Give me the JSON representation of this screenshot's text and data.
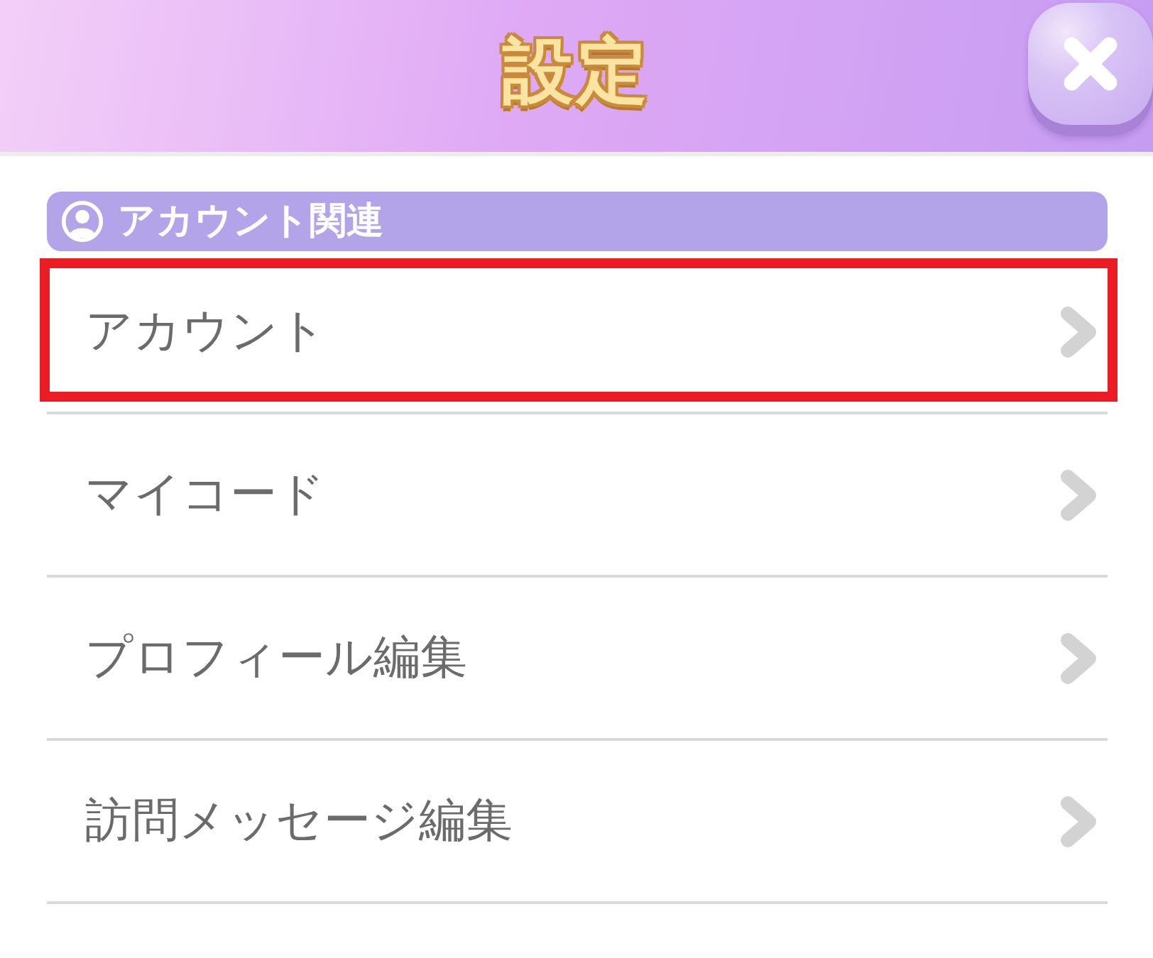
{
  "header": {
    "title": "設定"
  },
  "section": {
    "title": "アカウント関連"
  },
  "items": [
    {
      "label": "アカウント",
      "highlighted": true
    },
    {
      "label": "マイコード",
      "highlighted": false
    },
    {
      "label": "プロフィール編集",
      "highlighted": false
    },
    {
      "label": "訪問メッセージ編集",
      "highlighted": false
    }
  ]
}
